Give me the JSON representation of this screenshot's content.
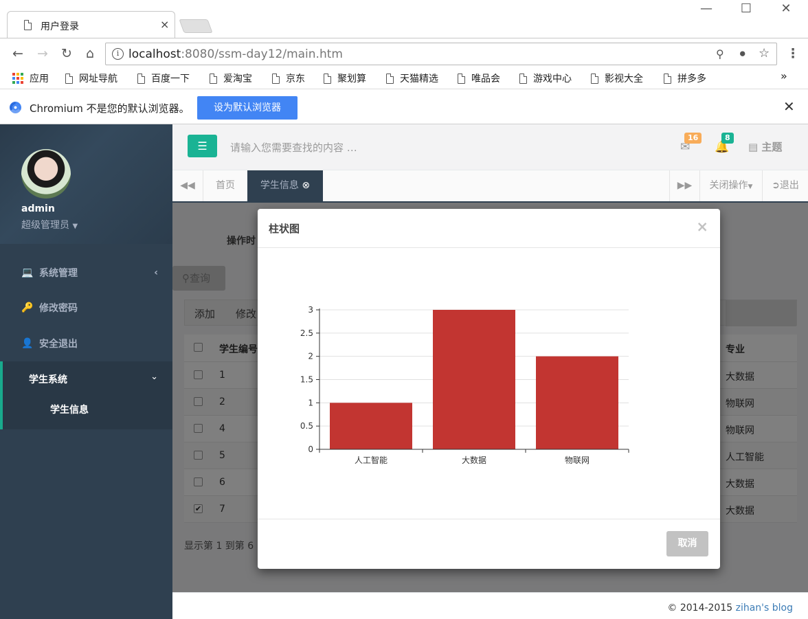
{
  "browser": {
    "tab_title": "用户登录",
    "tab_close": "×",
    "url_host": "localhost",
    "url_rest": ":8080/ssm-day12/main.htm",
    "window_controls": [
      "minimize-icon",
      "maximize-icon",
      "close-icon"
    ],
    "bookmarks": [
      {
        "label": "应用",
        "icon": "apps-grid-icon"
      },
      {
        "label": "网址导航",
        "icon": "doc-icon"
      },
      {
        "label": "百度一下",
        "icon": "doc-icon"
      },
      {
        "label": "爱淘宝",
        "icon": "doc-icon"
      },
      {
        "label": "京东",
        "icon": "doc-icon"
      },
      {
        "label": "聚划算",
        "icon": "doc-icon"
      },
      {
        "label": "天猫精选",
        "icon": "doc-icon"
      },
      {
        "label": "唯品会",
        "icon": "doc-icon"
      },
      {
        "label": "游戏中心",
        "icon": "doc-icon"
      },
      {
        "label": "影视大全",
        "icon": "doc-icon"
      },
      {
        "label": "拼多多",
        "icon": "doc-icon"
      }
    ],
    "bookmarks_overflow": "»",
    "infobar_text": "Chromium 不是您的默认浏览器。",
    "infobar_button": "设为默认浏览器"
  },
  "sidebar": {
    "user_name": "admin",
    "user_role": "超级管理员",
    "menu": [
      {
        "label": "系统管理",
        "icon": "desktop-icon",
        "has_chevron": true
      },
      {
        "label": "修改密码",
        "icon": "key-icon",
        "has_chevron": false
      },
      {
        "label": "安全退出",
        "icon": "user-remove-icon",
        "has_chevron": false
      }
    ],
    "active_group": "学生系统",
    "active_sub": "学生信息"
  },
  "header": {
    "search_placeholder": "请输入您需要查找的内容 …",
    "mail_count": "16",
    "bell_count": "8",
    "theme_label": "主题",
    "colors": {
      "mail_badge": "#f8ac59",
      "bell_badge": "#1ab394",
      "toggle": "#1ab394"
    }
  },
  "tabs": {
    "home": "首页",
    "active": "学生信息",
    "close_ops": "关闭操作",
    "logout": "退出"
  },
  "page": {
    "op_label": "操作时",
    "query_button": "查询",
    "toolbar": [
      "添加",
      "修改"
    ],
    "table_headers": {
      "id": "学生编号",
      "major": "专业"
    },
    "rows": [
      {
        "id": "1",
        "major": "大数据",
        "checked": false
      },
      {
        "id": "2",
        "major": "物联网",
        "checked": false
      },
      {
        "id": "4",
        "major": "物联网",
        "checked": false
      },
      {
        "id": "5",
        "major": "人工智能",
        "checked": false
      },
      {
        "id": "6",
        "major": "大数据",
        "checked": false
      },
      {
        "id": "7",
        "major": "大数据",
        "checked": true
      }
    ],
    "page_info": "显示第 1 到第 6",
    "footer_prefix": "© 2014-2015 ",
    "footer_link": "zihan's blog"
  },
  "modal": {
    "title": "柱状图",
    "close": "×",
    "cancel": "取消"
  },
  "chart_data": {
    "type": "bar",
    "categories": [
      "人工智能",
      "大数据",
      "物联网"
    ],
    "values": [
      1,
      3,
      2
    ],
    "ylim": [
      0,
      3
    ],
    "yticks": [
      "0",
      "0.5",
      "1",
      "1.5",
      "2",
      "2.5",
      "3"
    ],
    "bar_color": "#c23531",
    "grid": true,
    "title": "",
    "xlabel": "",
    "ylabel": ""
  }
}
